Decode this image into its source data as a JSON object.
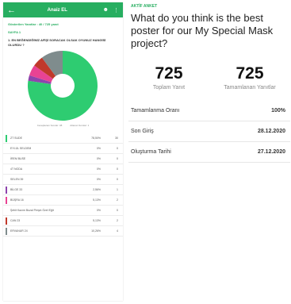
{
  "phone": {
    "header_title": "Anaiz EL",
    "back_icon": "arrow-left-icon",
    "icons": [
      "user-icon",
      "more-vertical-icon"
    ],
    "responses_line": "Gösterilen Yanıtlar : 40 / 725 yanıt",
    "page_label": "SAYFA 1",
    "question": "1. EN BEĞENDİĞİNİZ AFİŞİ SORACAK OLSAK OYUNUZ HANGİSİ OLURDU ?",
    "legend_answered": "Cevaplanan Sorular: 38",
    "legend_skipped": "Atlanan Sorular: 1",
    "colors": {
      "header": "#27ae60",
      "donut_main": "#2ecc71"
    },
    "rows": [
      {
        "label": "ZT SUDE",
        "pct": "78,50%",
        "count": "30",
        "color": "#2ecc71"
      },
      {
        "label": "EYLÜL SELDEM",
        "pct": "0%",
        "count": "0",
        "color": ""
      },
      {
        "label": "İREM BUSE",
        "pct": "0%",
        "count": "0",
        "color": ""
      },
      {
        "label": "4T NODA",
        "pct": "0%",
        "count": "0",
        "color": ""
      },
      {
        "label": "SELEN 39",
        "pct": "0%",
        "count": "0",
        "color": ""
      },
      {
        "label": "BİLGE 33",
        "pct": "2,56%",
        "count": "1",
        "color": "#8e44ad"
      },
      {
        "label": "BÜŞRA 16",
        "pct": "5,13%",
        "count": "2",
        "color": "#e84393"
      },
      {
        "label": "Şehit Kazım Bozal Perşin Özel Eğit",
        "pct": "0%",
        "count": "0",
        "color": ""
      },
      {
        "label": "CAN 23",
        "pct": "5,13%",
        "count": "2",
        "color": "#c0392b"
      },
      {
        "label": "ERVANUR 24",
        "pct": "10,26%",
        "count": "4",
        "color": "#7f8c8d"
      }
    ]
  },
  "chart_data": {
    "type": "pie",
    "style": "donut",
    "categories": [
      "ZT SUDE",
      "BİLGE 33",
      "BÜŞRA 16",
      "CAN 23",
      "ERVANUR 24"
    ],
    "values": [
      78.5,
      2.56,
      5.13,
      5.13,
      10.26
    ],
    "colors": [
      "#2ecc71",
      "#8e44ad",
      "#e84393",
      "#c0392b",
      "#7f8c8d"
    ]
  },
  "card": {
    "tag": "AKTİF ANKET",
    "title": "What do you think is the best poster for our My Special Mask project?",
    "total_value": "725",
    "total_label": "Toplam Yanıt",
    "completed_value": "725",
    "completed_label": "Tamamlanan Yanıtlar",
    "details": [
      {
        "key": "Tamamlanma Oranı",
        "value": "100%"
      },
      {
        "key": "Son Giriş",
        "value": "28.12.2020"
      },
      {
        "key": "Oluşturma Tarihi",
        "value": "27.12.2020"
      }
    ]
  }
}
